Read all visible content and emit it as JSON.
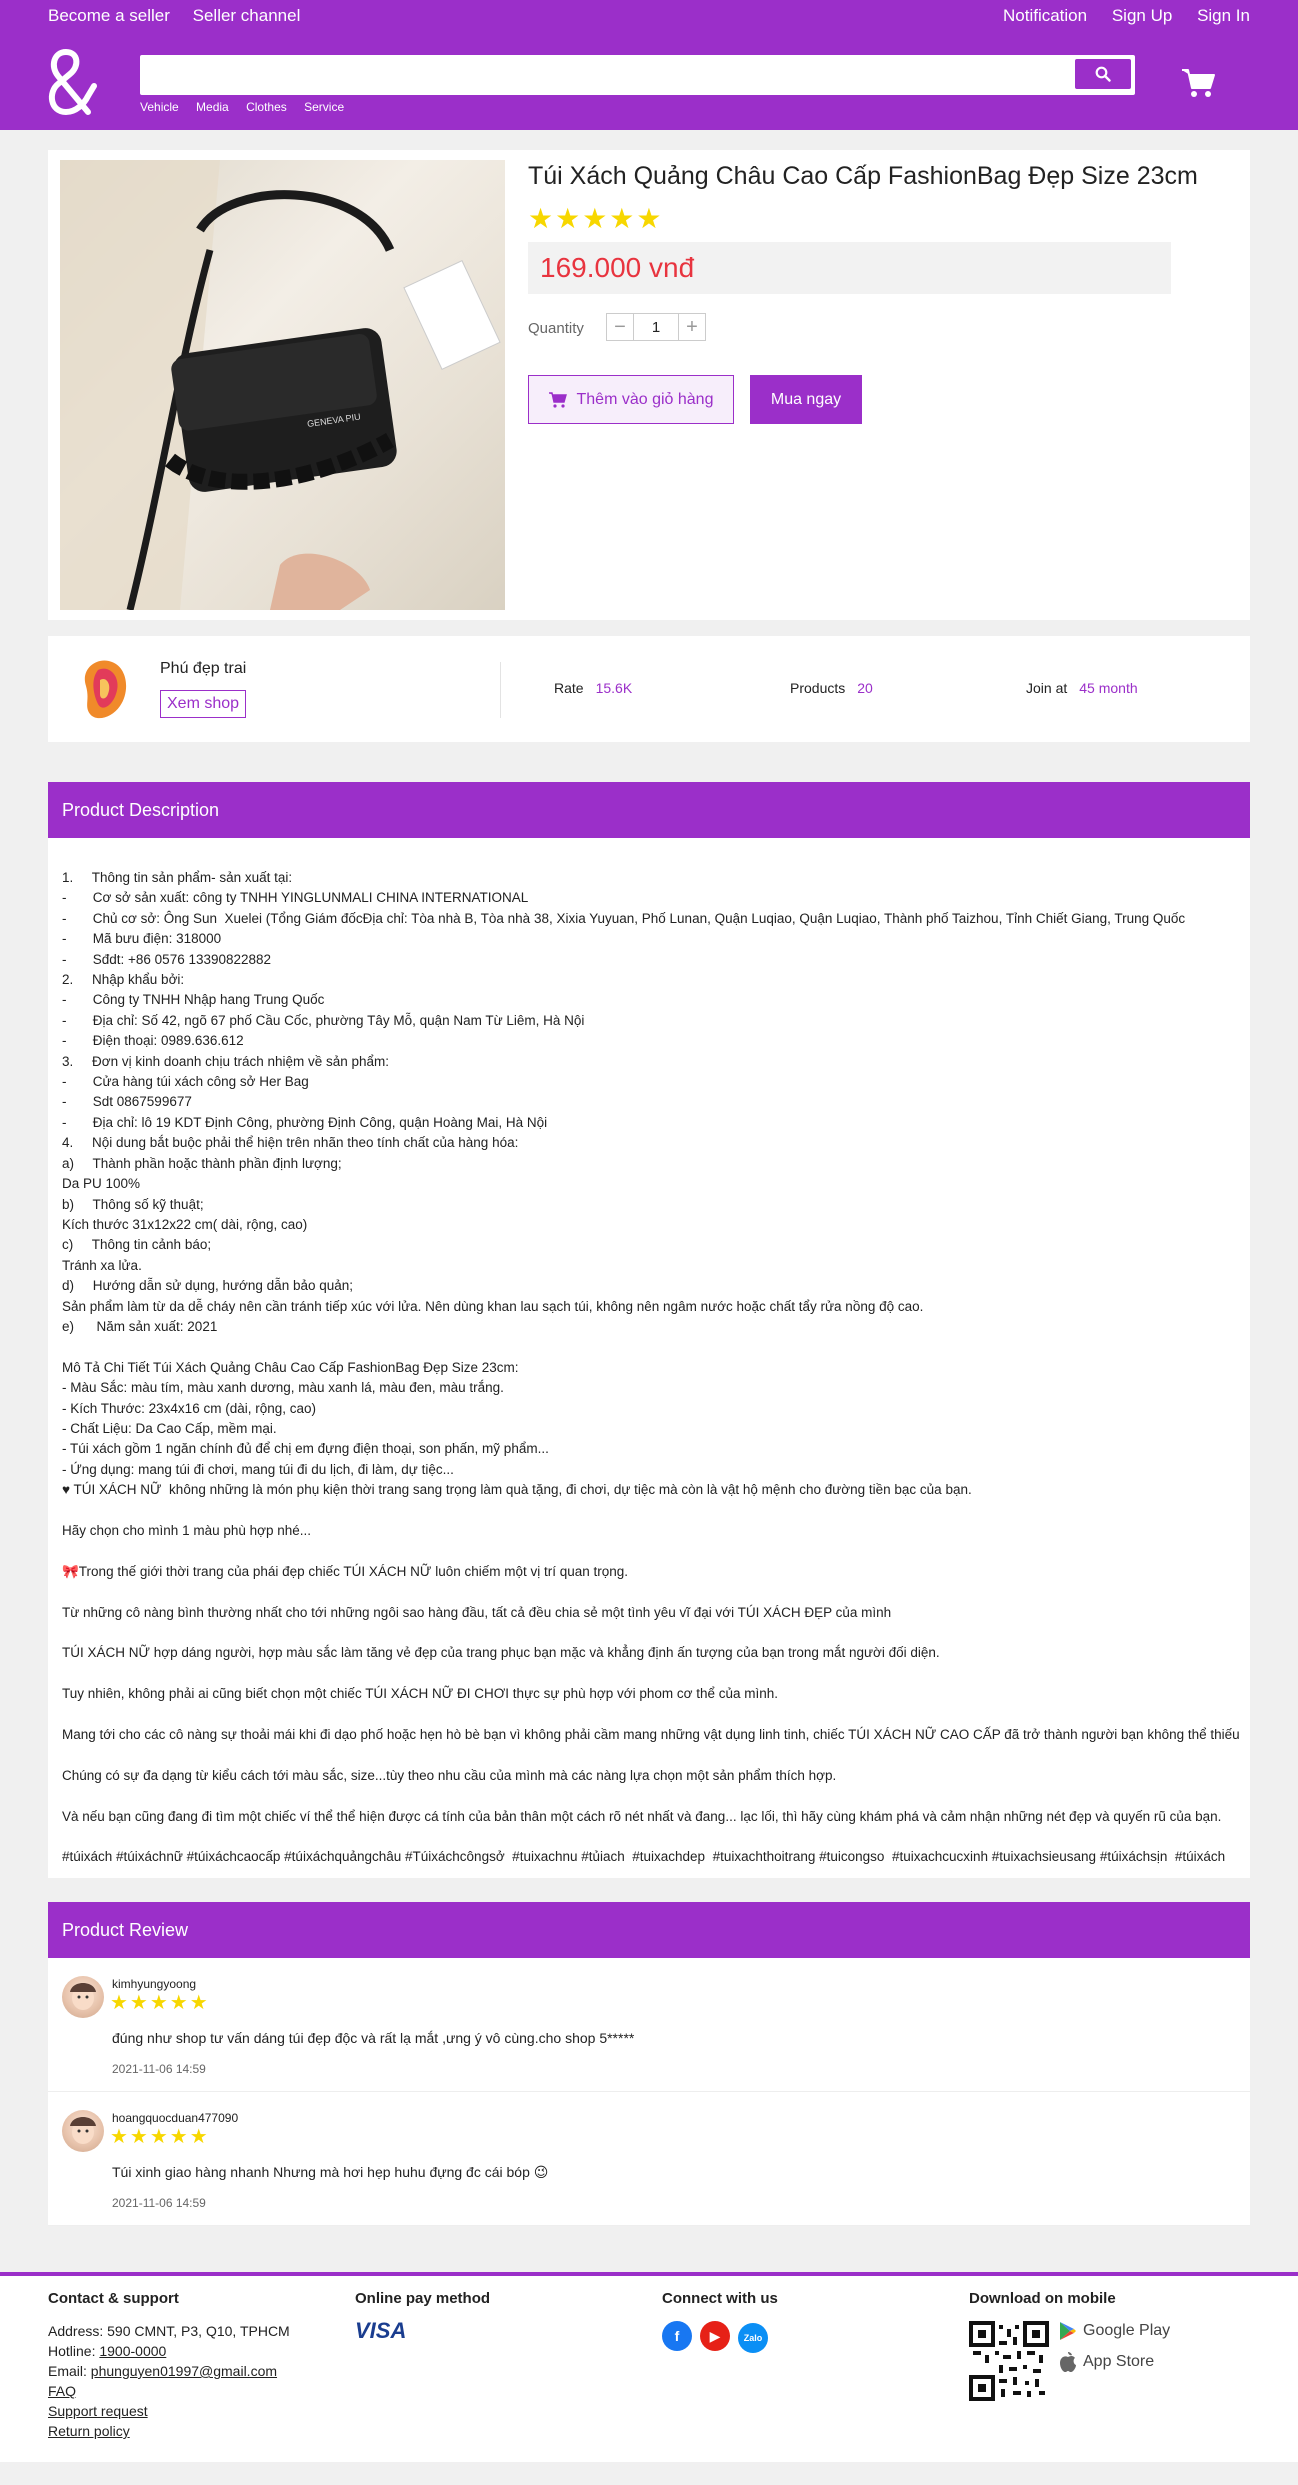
{
  "colors": {
    "accent": "#9b2fc9",
    "price": "#e8343f",
    "star": "#f7d700"
  },
  "topbar": {
    "become_seller": "Become a seller",
    "seller_channel": "Seller channel",
    "notification": "Notification",
    "sign_up": "Sign Up",
    "sign_in": "Sign In"
  },
  "search": {
    "value": "",
    "categories": [
      "Vehicle",
      "Media",
      "Clothes",
      "Service"
    ]
  },
  "product": {
    "title": "Túi Xách Quảng Châu Cao Cấp FashionBag Đẹp Size 23cm",
    "rating_stars": "★★★★★",
    "price": "169.000 vnđ",
    "quantity_label": "Quantity",
    "quantity": "1",
    "add_to_cart": "Thêm vào giỏ hàng",
    "buy_now": "Mua ngay",
    "image_tag_text": "GENEVA PIU"
  },
  "shop": {
    "name": "Phú đẹp trai",
    "view_shop": "Xem shop",
    "rate_label": "Rate",
    "rate_value": "15.6K",
    "products_label": "Products",
    "products_value": "20",
    "join_label": "Join at",
    "join_value": "45 month"
  },
  "description": {
    "title": "Product Description",
    "lines": [
      "1.     Thông tin sản phẩm- sản xuất tại:",
      "-       Cơ sở sản xuất: công ty TNHH YINGLUNMALI CHINA INTERNATIONAL",
      "-       Chủ cơ sở: Ông Sun  Xuelei (Tổng Giám đốcĐịa chỉ: Tòa nhà B, Tòa nhà 38, Xixia Yuyuan, Phố Lunan, Quận Luqiao, Quận Luqiao, Thành phố Taizhou, Tỉnh Chiết Giang, Trung Quốc",
      "-       Mã bưu điện: 318000",
      "-       Sđdt: +86 0576 13390822882",
      "2.     Nhập khẩu bởi:",
      "-       Công ty TNHH Nhập hang Trung Quốc",
      "-       Địa chỉ: Số 42, ngõ 67 phố Cầu Cốc, phường Tây Mỗ, quận Nam Từ Liêm, Hà Nội",
      "-       Điện thoại: 0989.636.612",
      "3.     Đơn vị kinh doanh chịu trách nhiệm về sản phẩm:",
      "-       Cửa hàng túi xách công sở Her Bag",
      "-       Sdt 0867599677",
      "-       Địa chỉ: lô 19 KDT Định Công, phường Định Công, quận Hoàng Mai, Hà Nội",
      "4.     Nội dung bắt buộc phải thể hiện trên nhãn theo tính chất của hàng hóa:",
      "a)     Thành phần hoặc thành phần định lượng;",
      "Da PU 100%",
      "b)     Thông số kỹ thuật;",
      "Kích thước 31x12x22 cm( dài, rộng, cao)",
      "c)     Thông tin cảnh báo;",
      "Tránh xa lửa.",
      "d)     Hướng dẫn sử dụng, hướng dẫn bảo quản;",
      "Sản phẩm làm từ da dễ cháy nên cần tránh tiếp xúc với lửa. Nên dùng khan lau sạch túi, không nên ngâm nước hoặc chất tẩy rửa nồng độ cao.",
      "e)      Năm sản xuất: 2021",
      "",
      "Mô Tả Chi Tiết Túi Xách Quảng Châu Cao Cấp FashionBag Đẹp Size 23cm:",
      "- Màu Sắc: màu tím, màu xanh dương, màu xanh lá, màu đen, màu trắng.",
      "- Kích Thước: 23x4x16 cm (dài, rộng, cao)",
      "- Chất Liệu: Da Cao Cấp, mềm mại.",
      "- Túi xách gồm 1 ngăn chính đủ để chị em đựng điện thoại, son phấn, mỹ phẩm...",
      "- Ứng dụng: mang túi đi chơi, mang túi đi du lịch, đi làm, dự tiệc...",
      "♥ TÚI XÁCH NỮ  không những là món phụ kiện thời trang sang trọng làm quà tặng, đi chơi, dự tiệc mà còn là vật hộ mệnh cho đường tiền bạc của bạn.",
      "",
      "Hãy chọn cho mình 1 màu phù hợp nhé...",
      "",
      "🎀Trong thế giới thời trang của phái đẹp chiếc TÚI XÁCH NỮ luôn chiếm một vị trí quan trọng.",
      "",
      "Từ những cô nàng bình thường nhất cho tới những ngôi sao hàng đầu, tất cả đều chia sẻ một tình yêu vĩ đại với TÚI XÁCH ĐẸP của mình",
      "",
      "TÚI XÁCH NỮ hợp dáng người, hợp màu sắc làm tăng vẻ đẹp của trang phục bạn mặc và khẳng định ấn tượng của bạn trong mắt người đối diện.",
      "",
      "Tuy nhiên, không phải ai cũng biết chọn một chiếc TÚI XÁCH NỮ ĐI CHƠI thực sự phù hợp với phom cơ thể của mình.",
      "",
      "Mang tới cho các cô nàng sự thoải mái khi đi dạo phố hoặc hẹn hò bè bạn vì không phải cầm mang những vật dụng linh tinh, chiếc TÚI XÁCH NỮ CAO CẤP đã trở thành người bạn không thể thiếu",
      "",
      "Chúng có sự đa dạng từ kiểu cách tới màu sắc, size...tùy theo nhu cầu của mình mà các nàng lựa chọn một sản phẩm thích hợp.",
      "",
      "Và nếu bạn cũng đang đi tìm một chiếc ví thể thể hiện được cá tính của bản thân một cách rõ nét nhất và đang... lạc lối, thì hãy cùng khám phá và cảm nhận những nét đẹp và quyến rũ của bạn.",
      "",
      "#túixách #túixáchnữ #túixáchcaocấp #túixáchquảngchâu #Túixáchcôngsở  #tuixachnu #tủiach  #tuixachdep  #tuixachthoitrang #tuicongso  #tuixachcucxinh #tuixachsieusang #túixáchsịn  #túixách"
    ]
  },
  "reviews": {
    "title": "Product Review",
    "items": [
      {
        "user": "kimhyungyoong",
        "stars": "★★★★★",
        "text": "đúng như shop tư vấn dáng túi đẹp độc và rất lạ mắt ,ưng ý vô cùng.cho shop 5*****",
        "time": "2021-11-06 14:59"
      },
      {
        "user": "hoangquocduan477090",
        "stars": "★★★★★",
        "text": "Túi xinh giao hàng nhanh Nhưng mà hơi hẹp huhu đựng đc cái bóp 😉",
        "time": "2021-11-06 14:59"
      }
    ]
  },
  "footer": {
    "contact_title": "Contact & support",
    "address": "Address: 590 CMNT, P3, Q10, TPHCM",
    "hotline_label": "Hotline: ",
    "hotline": "1900-0000",
    "email_label": "Email: ",
    "email": "phunguyen01997@gmail.com",
    "faq": "FAQ",
    "support": "Support request",
    "return_policy": "Return policy",
    "pay_title": "Online pay method",
    "visa": "VISA",
    "connect_title": "Connect with us",
    "zalo": "Zalo",
    "mobile_title": "Download on mobile",
    "google_play": "Google Play",
    "app_store": "App Store"
  }
}
